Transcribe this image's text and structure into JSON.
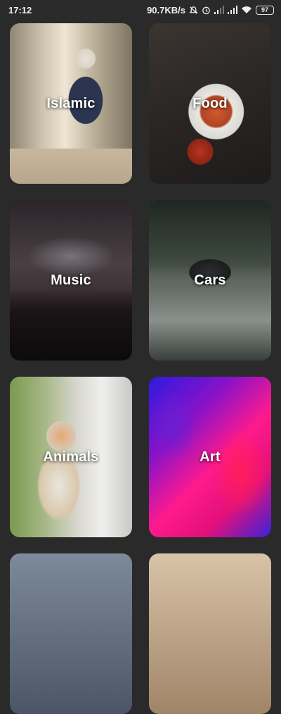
{
  "status_bar": {
    "time": "17:12",
    "network_speed": "90.7KB/s",
    "battery_level": "97",
    "icons": [
      "mute-icon",
      "alarm-icon",
      "signal-icon",
      "signal-icon",
      "wifi-icon",
      "battery-icon"
    ]
  },
  "categories": [
    {
      "label": "Islamic",
      "image": "girl-reading-quran-photo"
    },
    {
      "label": "Food",
      "image": "kebab-plate-photo"
    },
    {
      "label": "Music",
      "image": "concert-crowd-photo"
    },
    {
      "label": "Cars",
      "image": "sports-car-photo"
    },
    {
      "label": "Animals",
      "image": "kitten-photo"
    },
    {
      "label": "Art",
      "image": "abstract-paint-photo"
    }
  ],
  "colors": {
    "background": "#2a2a2a",
    "label_text": "#ffffff"
  }
}
